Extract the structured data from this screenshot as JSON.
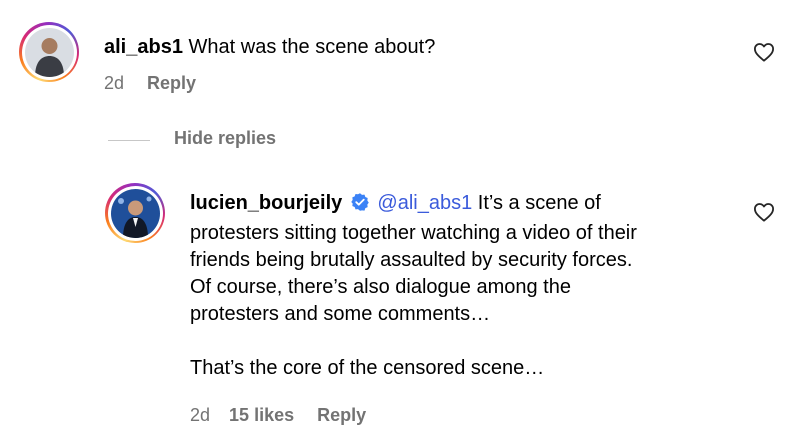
{
  "comment": {
    "username": "ali_abs1",
    "text": "What was the scene about?",
    "time": "2d",
    "reply_label": "Reply",
    "like_icon": "heart-icon"
  },
  "hide_replies_label": "Hide replies",
  "reply": {
    "username": "lucien_bourjeily",
    "verified_icon": "verified-badge-icon",
    "mention": "@ali_abs1",
    "lines": [
      " It’s a scene of",
      "protesters sitting together watching a video of their",
      "friends being brutally assaulted by security forces.",
      "Of course, there’s also dialogue among the",
      "protesters and some comments…",
      "",
      "That’s the core of the censored scene…"
    ],
    "time": "2d",
    "likes": "15 likes",
    "reply_label": "Reply",
    "like_icon": "heart-icon"
  },
  "colors": {
    "mention": "#3b5bdb",
    "meta": "#737373",
    "verified": "#3b82f6"
  }
}
